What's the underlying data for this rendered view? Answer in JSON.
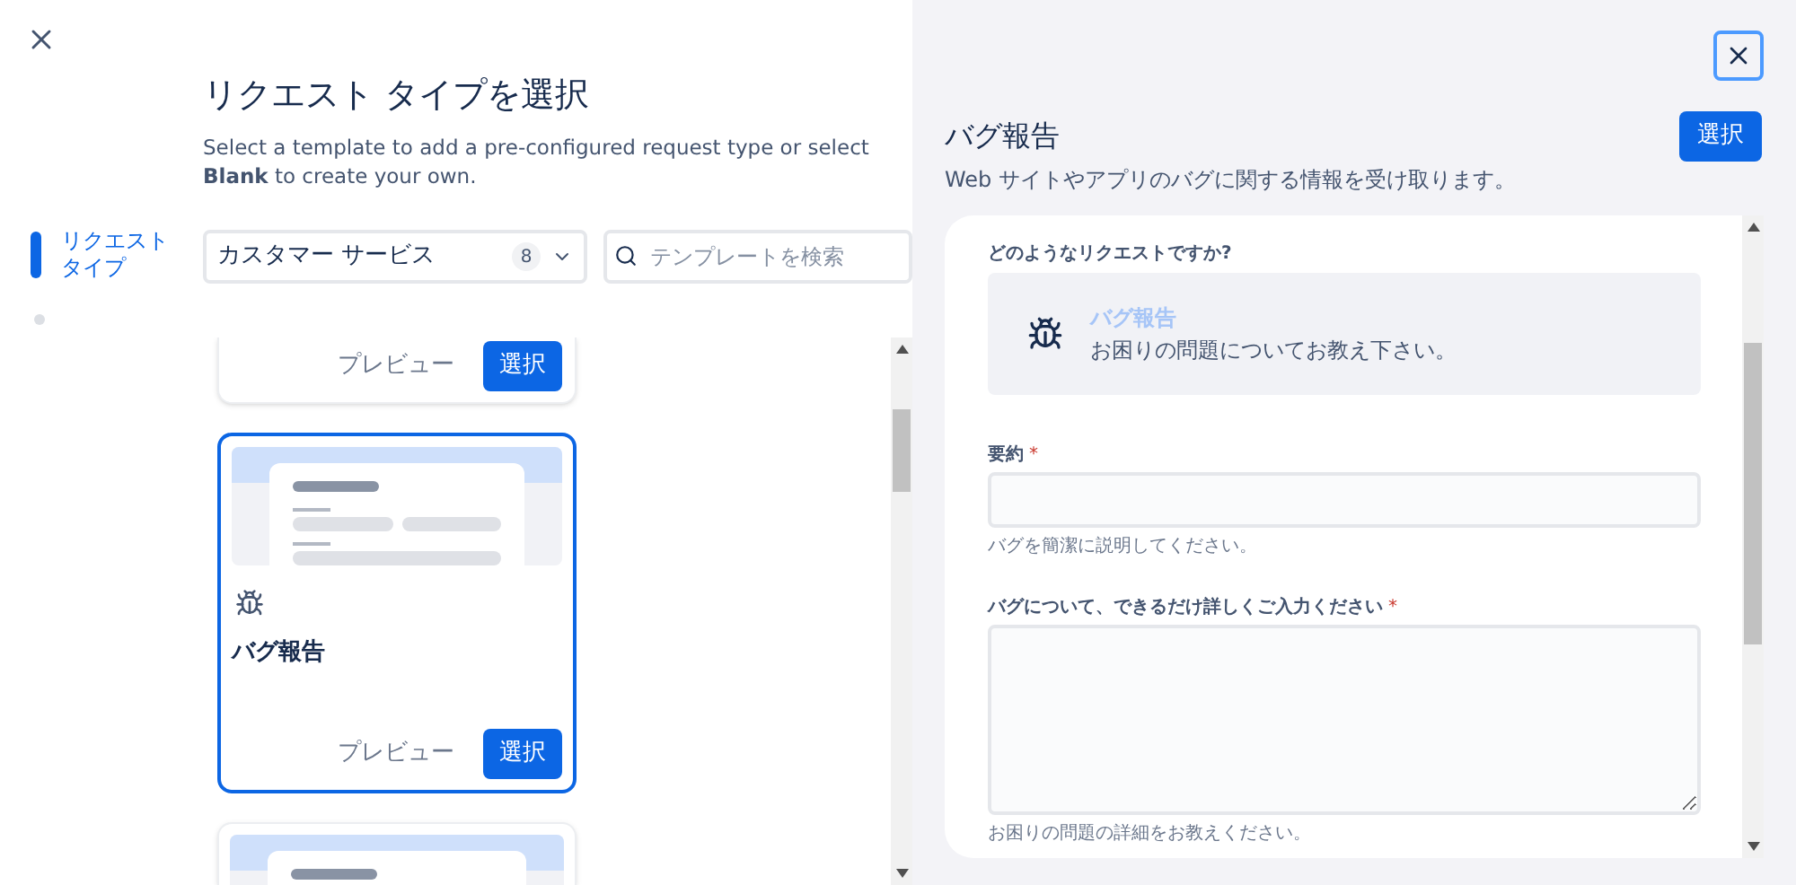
{
  "left": {
    "title": "リクエスト タイプを選択",
    "description": "Select a template to add a pre-configured request type or select **Blank** to create your own.",
    "steps": [
      {
        "label": "リクエストタイプ",
        "selected": true
      },
      {
        "selected": false
      }
    ],
    "category": {
      "value": "カスタマー サービス",
      "count": "8"
    },
    "search": {
      "placeholder": "テンプレートを検索"
    },
    "cards": [
      {
        "kind": "footer",
        "selected": false,
        "preview_button": "プレビュー",
        "select_button": "選択"
      },
      {
        "kind": "full",
        "selected": true,
        "title": "バグ報告",
        "preview_button": "プレビュー",
        "select_button": "選択"
      },
      {
        "kind": "top",
        "selected": false
      }
    ]
  },
  "preview": {
    "title": "バグ報告",
    "select_button": "選択",
    "description": "Web サイトやアプリのバグに関する情報を受け取ります。",
    "request_label": "どのようなリクエストですか?",
    "request_type": {
      "title": "バグ報告",
      "description": "お困りの問題についてお教え下さい。"
    },
    "fields": [
      {
        "kind": "input",
        "label": "要約",
        "required_mark": "*",
        "help": "バグを簡潔に説明してください。"
      },
      {
        "kind": "textarea",
        "label": "バグについて、できるだけ詳しくご入力ください",
        "required_mark": "*",
        "help": "お困りの問題の詳細をお教えください。"
      }
    ]
  }
}
